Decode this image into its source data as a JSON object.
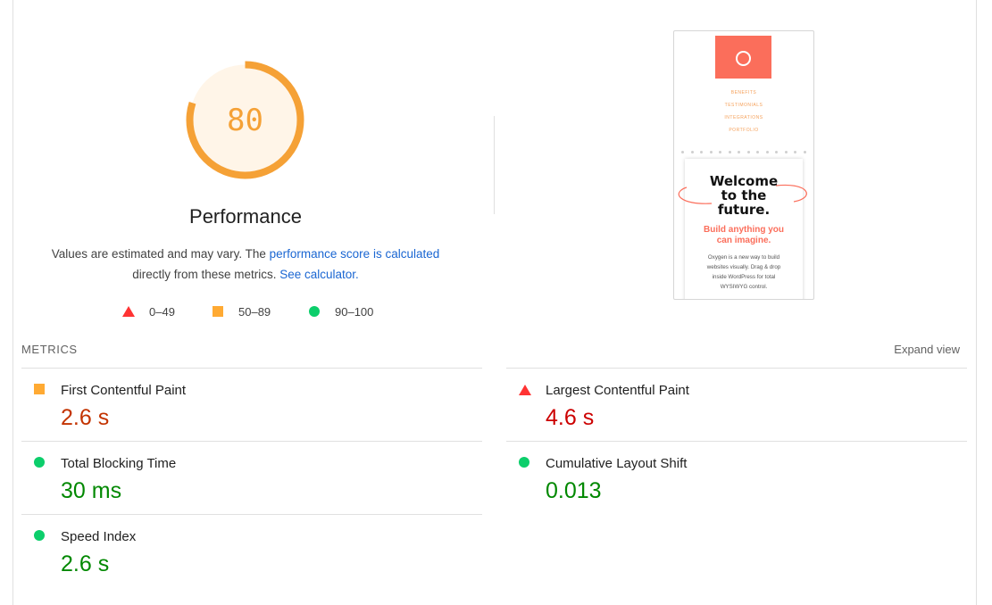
{
  "score": {
    "value": "80",
    "fraction": 0.8,
    "title": "Performance",
    "color": "#f5a136",
    "bg_color": "#fff5e8"
  },
  "description": {
    "part1": "Values are estimated and may vary. The ",
    "link1": "performance score is calculated",
    "part2": "directly from these metrics. ",
    "link2": "See calculator."
  },
  "legend": [
    {
      "icon": "red-triangle-icon",
      "range": "0–49"
    },
    {
      "icon": "orange-square-icon",
      "range": "50–89"
    },
    {
      "icon": "green-circle-icon",
      "range": "90–100"
    }
  ],
  "thumbnail": {
    "nav": [
      "BENEFITS",
      "TESTIMONIALS",
      "INTEGRATIONS",
      "PORTFOLIO"
    ],
    "hero": [
      "Welcome",
      "to the",
      "future."
    ],
    "subheading": [
      "Build anything you",
      "can imagine."
    ],
    "body": [
      "Oxygen is a new way to build",
      "websites visually. Drag & drop",
      "inside WordPress for total",
      "WYSIWYG control."
    ]
  },
  "metrics": {
    "title": "METRICS",
    "expand_label": "Expand view",
    "items": [
      {
        "label": "First Contentful Paint",
        "value": "2.6 s",
        "rating": "average",
        "icon": "orange-square-icon"
      },
      {
        "label": "Largest Contentful Paint",
        "value": "4.6 s",
        "rating": "fail",
        "icon": "red-triangle-icon"
      },
      {
        "label": "Total Blocking Time",
        "value": "30 ms",
        "rating": "pass",
        "icon": "green-circle-icon"
      },
      {
        "label": "Cumulative Layout Shift",
        "value": "0.013",
        "rating": "pass",
        "icon": "green-circle-icon"
      },
      {
        "label": "Speed Index",
        "value": "2.6 s",
        "rating": "pass",
        "icon": "green-circle-icon"
      }
    ]
  }
}
